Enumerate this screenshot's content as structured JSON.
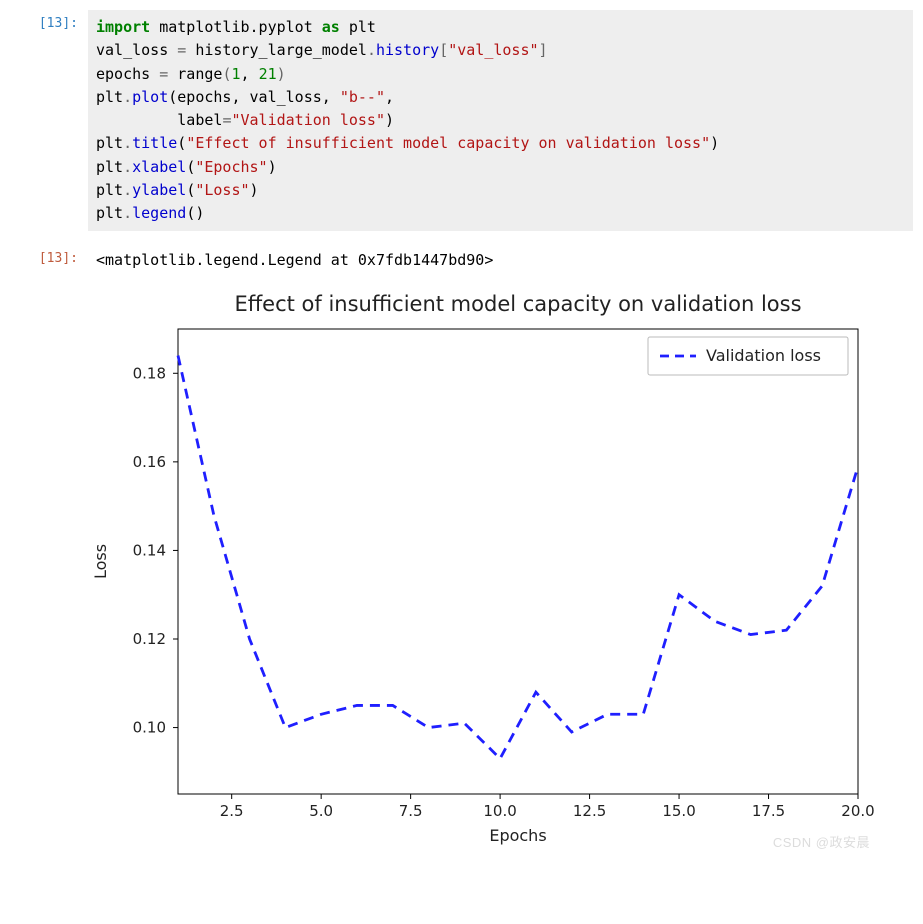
{
  "input_prompt": "[13]:",
  "output_prompt": "[13]:",
  "code": {
    "l1_kw1": "import",
    "l1_mod": " matplotlib.pyplot ",
    "l1_kw2": "as",
    "l1_alias": " plt",
    "l2a": "val_loss ",
    "l2op": "=",
    "l2b": " history_large_model",
    "l2dot": ".",
    "l2attr": "history",
    "l2br1": "[",
    "l2str": "\"val_loss\"",
    "l2br2": "]",
    "l3a": "epochs ",
    "l3op": "=",
    "l3b": " ",
    "l3fn": "range",
    "l3p": "(",
    "l3n1": "1",
    "l3c": ", ",
    "l3n2": "21",
    "l3p2": ")",
    "l4a": "plt",
    "l4dot": ".",
    "l4fn": "plot",
    "l4p": "(epochs, val_loss, ",
    "l4s1": "\"b--\"",
    "l4c": ",",
    "l5pad": "         label",
    "l5op": "=",
    "l5s": "\"Validation loss\"",
    "l5p": ")",
    "l6a": "plt",
    "l6dot": ".",
    "l6fn": "title",
    "l6p": "(",
    "l6s": "\"Effect of insufficient model capacity on validation loss\"",
    "l6p2": ")",
    "l7a": "plt",
    "l7dot": ".",
    "l7fn": "xlabel",
    "l7p": "(",
    "l7s": "\"Epochs\"",
    "l7p2": ")",
    "l8a": "plt",
    "l8dot": ".",
    "l8fn": "ylabel",
    "l8p": "(",
    "l8s": "\"Loss\"",
    "l8p2": ")",
    "l9a": "plt",
    "l9dot": ".",
    "l9fn": "legend",
    "l9p": "()"
  },
  "output_text": "<matplotlib.legend.Legend at 0x7fdb1447bd90>",
  "watermark": "CSDN @政安晨",
  "chart_data": {
    "type": "line",
    "title": "Effect of insufficient model capacity on validation loss",
    "xlabel": "Epochs",
    "ylabel": "Loss",
    "legend": "Validation loss",
    "x": [
      1,
      2,
      3,
      4,
      5,
      6,
      7,
      8,
      9,
      10,
      11,
      12,
      13,
      14,
      15,
      16,
      17,
      18,
      19,
      20
    ],
    "y": [
      0.184,
      0.148,
      0.12,
      0.1,
      0.103,
      0.105,
      0.105,
      0.1,
      0.101,
      0.093,
      0.108,
      0.099,
      0.103,
      0.103,
      0.13,
      0.124,
      0.121,
      0.122,
      0.132,
      0.159
    ],
    "xlim": [
      1,
      20
    ],
    "ylim": [
      0.085,
      0.19
    ],
    "xticks": [
      2.5,
      5.0,
      7.5,
      10.0,
      12.5,
      15.0,
      17.5,
      20.0
    ],
    "yticks": [
      0.1,
      0.12,
      0.14,
      0.16,
      0.18
    ],
    "style": "b--"
  }
}
